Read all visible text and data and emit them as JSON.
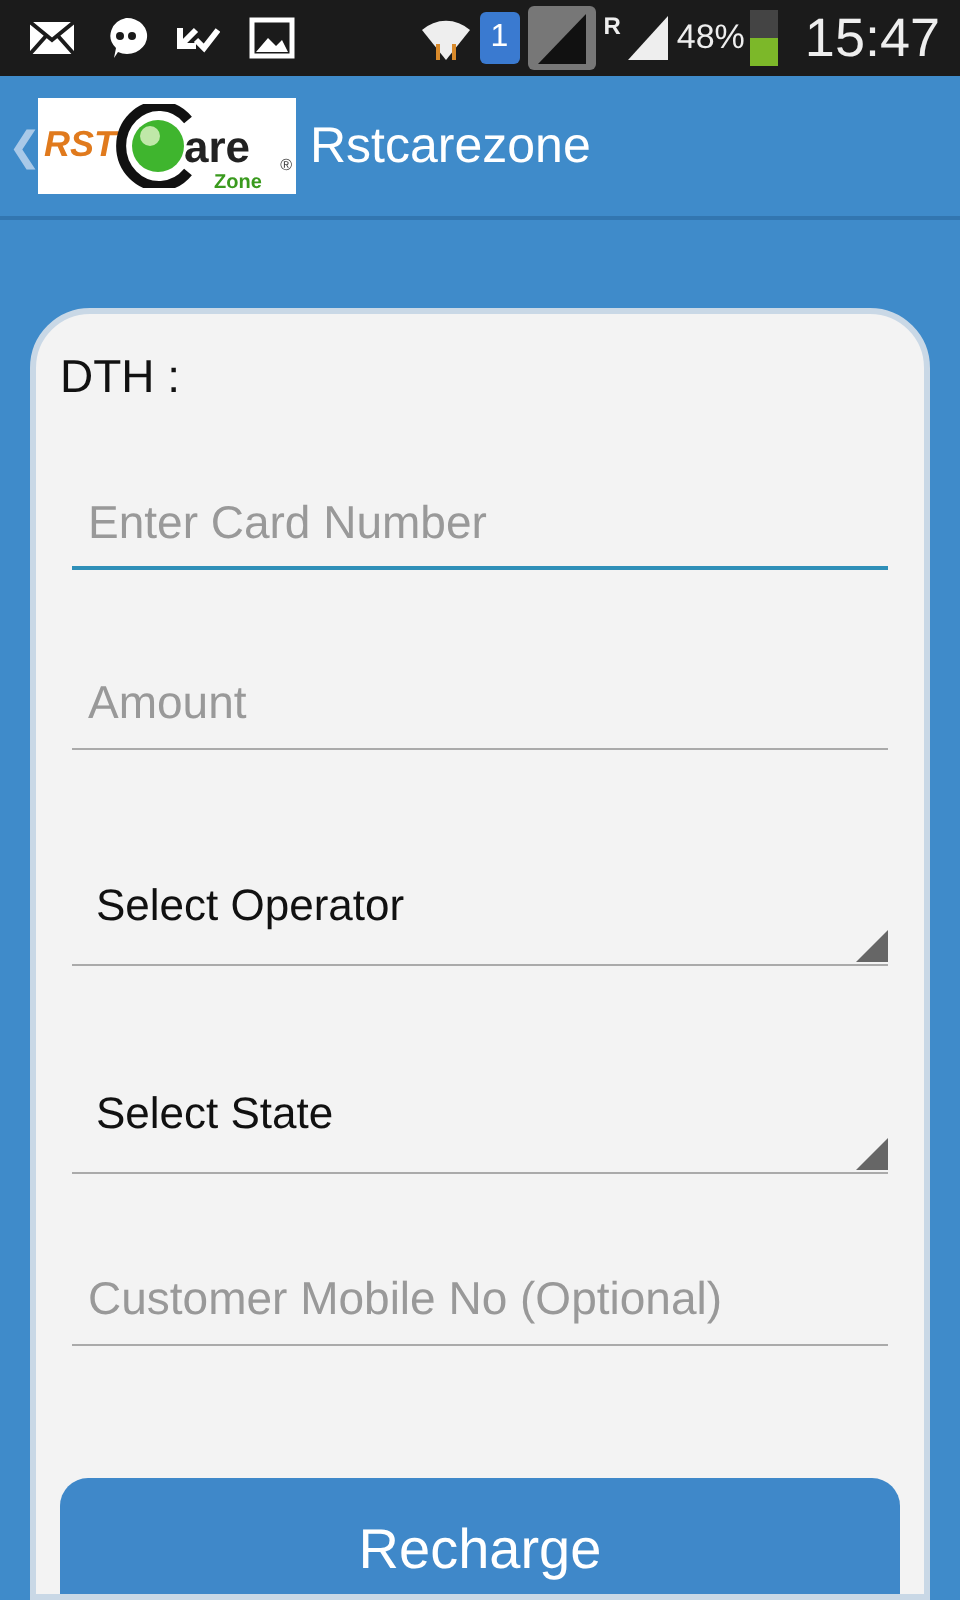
{
  "status_bar": {
    "sim_badge": "1",
    "roaming": "R",
    "battery_text": "48%",
    "time": "15:47"
  },
  "action_bar": {
    "back": "❮",
    "logo": {
      "left": "RST",
      "right": "are",
      "sub": "Zone",
      "mark": "®"
    },
    "title": "Rstcarezone"
  },
  "form": {
    "heading": "DTH :",
    "fields": [
      {
        "kind": "text",
        "placeholder": "Enter Card Number",
        "focused": true
      },
      {
        "kind": "text",
        "placeholder": "Amount",
        "focused": false
      },
      {
        "kind": "spinner",
        "value": "Select Operator"
      },
      {
        "kind": "spinner",
        "value": "Select State"
      },
      {
        "kind": "text",
        "placeholder": "Customer Mobile No (Optional)",
        "focused": false
      }
    ],
    "button": "Recharge"
  }
}
